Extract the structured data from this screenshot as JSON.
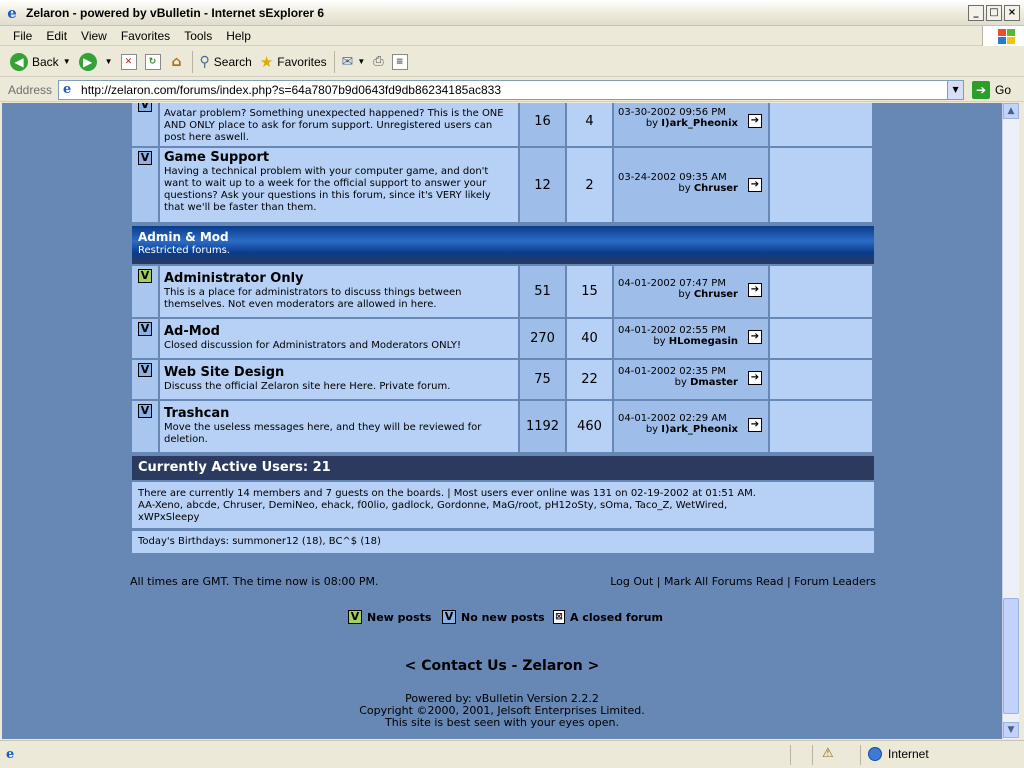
{
  "window": {
    "title": "Zelaron - powered by vBulletin - Internet sExplorer 6",
    "controls": [
      "_",
      "□",
      "×"
    ]
  },
  "menu": [
    "File",
    "Edit",
    "View",
    "Favorites",
    "Tools",
    "Help"
  ],
  "toolbar": {
    "back": "Back",
    "search": "Search",
    "favorites": "Favorites"
  },
  "address": {
    "label": "Address",
    "url": "http://zelaron.com/forums/index.php?s=64a7807b9d0643fd9db86234185ac833",
    "go": "Go"
  },
  "forums_top": [
    {
      "desc": "Avatar problem? Something unexpected happened? This is the ONE AND ONLY place to ask for forum support. Unregistered users can post here aswell.",
      "posts": "16",
      "threads": "4",
      "last_date": "03-30-2002 09:56 PM",
      "last_by": "I)ark_Pheonix",
      "icon": "V"
    },
    {
      "name": "Game Support",
      "desc": "Having a technical problem with your computer game, and don't want to wait up to a week for the official support to answer your questions? Ask your questions in this forum, since it's VERY likely that we'll be faster than them.",
      "posts": "12",
      "threads": "2",
      "last_date": "03-24-2002 09:35 AM",
      "last_by": "Chruser",
      "icon": "V"
    }
  ],
  "category": {
    "name": "Admin & Mod",
    "desc": "Restricted forums."
  },
  "forums_admin": [
    {
      "name": "Administrator Only",
      "desc": "This is a place for administrators to discuss things between themselves. Not even moderators are allowed in here.",
      "posts": "51",
      "threads": "15",
      "last_date": "04-01-2002 07:47 PM",
      "last_by": "Chruser",
      "icon": "V"
    },
    {
      "name": "Ad-Mod",
      "desc": "Closed discussion for Administrators and Moderators ONLY!",
      "posts": "270",
      "threads": "40",
      "last_date": "04-01-2002 02:55 PM",
      "last_by": "HLomegasin",
      "icon": "V"
    },
    {
      "name": "Web Site Design",
      "desc": "Discuss the official Zelaron site here Here. Private forum.",
      "posts": "75",
      "threads": "22",
      "last_date": "04-01-2002 02:35 PM",
      "last_by": "Dmaster",
      "icon": "V"
    },
    {
      "name": "Trashcan",
      "desc": "Move the useless messages here, and they will be reviewed for deletion.",
      "posts": "1192",
      "threads": "460",
      "last_date": "04-01-2002 02:29 AM",
      "last_by": "I)ark_Pheonix",
      "icon": "V"
    }
  ],
  "by_label": "by",
  "goto_glyph": "➔",
  "active": {
    "title": "Currently Active Users: 21",
    "summary": "There are currently 14 members and 7 guests on the boards. | Most users ever online was 131 on 02-19-2002 at 01:51 AM.",
    "users_line1": "AA-Xeno, abcde, Chruser, DemiNeo, ehack, f00lio, gadlock, Gordonne, MaG/root, pH12oSty, sOma, Taco_Z, WetWired,",
    "users_line2": "xWPxSleepy",
    "birthdays": "Today's Birthdays: summoner12 (18), BC^$ (18)"
  },
  "footer": {
    "time": "All times are GMT. The time now is 08:00 PM.",
    "links": "Log Out | Mark All Forums Read | Forum Leaders",
    "legend_new": "New posts",
    "legend_nonew": "No new posts",
    "legend_closed": "A closed forum",
    "contact": "< Contact Us - Zelaron >",
    "powered1": "Powered by: vBulletin Version 2.2.2",
    "powered2": "Copyright ©2000, 2001, Jelsoft Enterprises Limited.",
    "powered3": "This site is best seen with your eyes open."
  },
  "status": {
    "zone": "Internet"
  },
  "colors": {
    "page_bg": "#6787b5",
    "cell_light": "#b6d1f5",
    "cell_dark": "#9ebde9",
    "header_dark": "#2b3a5e"
  }
}
